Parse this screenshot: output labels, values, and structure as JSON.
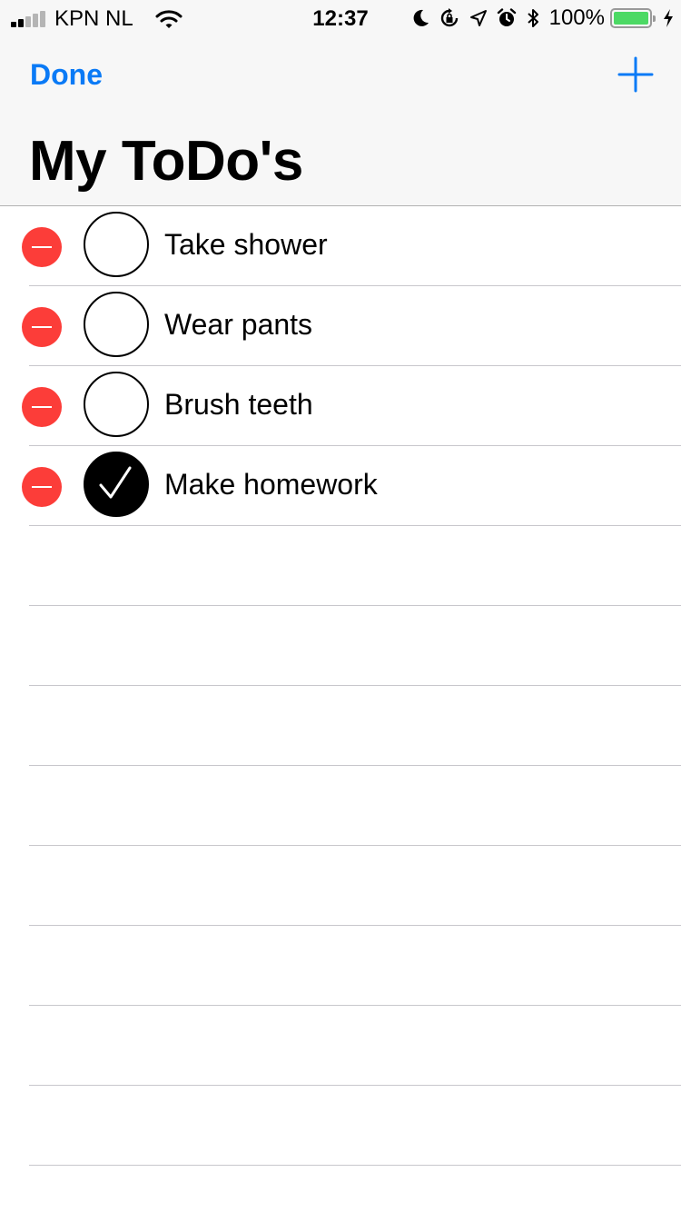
{
  "status_bar": {
    "carrier": "KPN NL",
    "time": "12:37",
    "battery_percent": "100%",
    "battery_level": 1.0,
    "icons": [
      "signal-icon",
      "wifi-icon",
      "moon-icon",
      "rotation-lock-icon",
      "location-icon",
      "alarm-icon",
      "bluetooth-icon",
      "battery-icon",
      "charging-icon"
    ]
  },
  "nav": {
    "done_label": "Done",
    "add_icon": "plus-icon",
    "title": "My ToDo's"
  },
  "colors": {
    "accent": "#0a7af6",
    "delete": "#fc3d39",
    "battery": "#4cd964"
  },
  "todos": [
    {
      "label": "Take shower",
      "completed": false
    },
    {
      "label": "Wear pants",
      "completed": false
    },
    {
      "label": "Brush teeth",
      "completed": false
    },
    {
      "label": "Make homework",
      "completed": true
    }
  ]
}
